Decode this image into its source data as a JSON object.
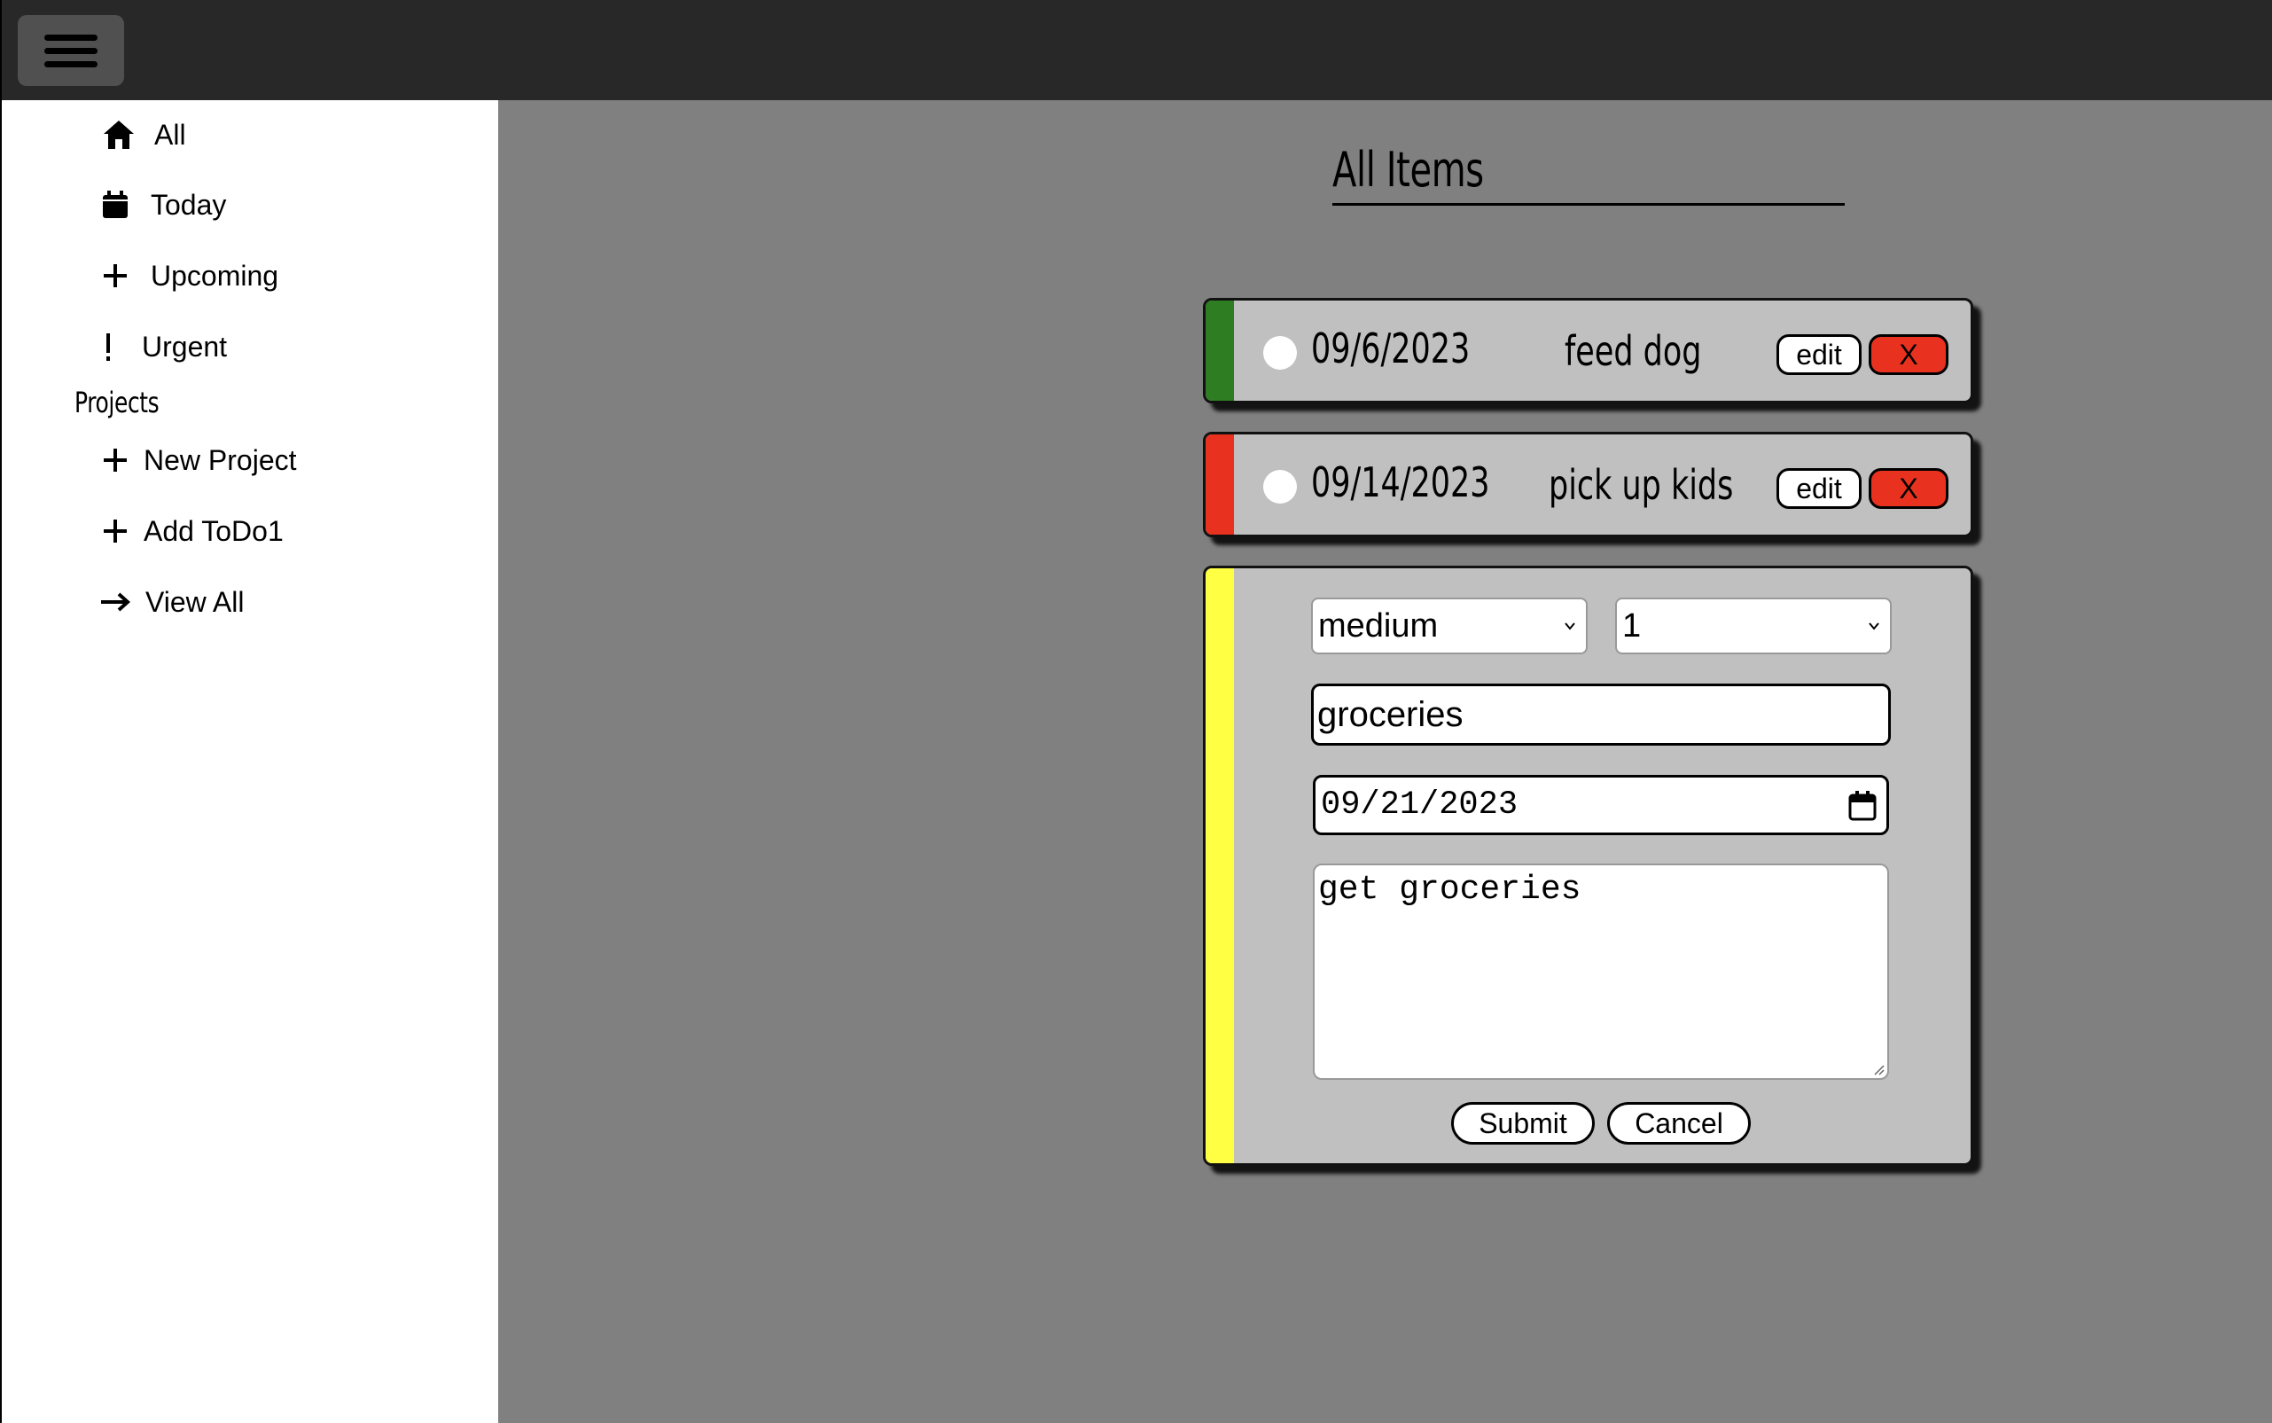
{
  "topbar": {
    "menu_icon": "hamburger-menu-icon"
  },
  "sidebar": {
    "items": [
      {
        "label": "All",
        "icon": "home-icon"
      },
      {
        "label": "Today",
        "icon": "calendar-icon"
      },
      {
        "label": "Upcoming",
        "icon": "plus-icon"
      },
      {
        "label": "Urgent",
        "icon": "exclamation-icon"
      }
    ],
    "projects_heading": "Projects",
    "project_items": [
      {
        "label": "New Project",
        "icon": "plus-icon"
      },
      {
        "label": "Add ToDo1",
        "icon": "plus-icon"
      },
      {
        "label": "View All",
        "icon": "arrow-right-icon"
      }
    ]
  },
  "main": {
    "page_title": "All Items",
    "todos": [
      {
        "date": "09/6/2023",
        "title": "feed dog",
        "priority_color": "#2e7d22",
        "edit_label": "edit",
        "delete_label": "X"
      },
      {
        "date": "09/14/2023",
        "title": "pick up kids",
        "priority_color": "#e8321f",
        "edit_label": "edit",
        "delete_label": "X"
      }
    ],
    "form": {
      "priority_color": "#ffff44",
      "priority_select": "medium",
      "project_select": "1",
      "title_value": "groceries",
      "date_value": "09/21/2023",
      "description_value": "get groceries",
      "submit_label": "Submit",
      "cancel_label": "Cancel"
    }
  },
  "colors": {
    "topbar": "#282828",
    "background": "#808080",
    "card": "#c0c0c0",
    "delete": "#e8321f"
  }
}
